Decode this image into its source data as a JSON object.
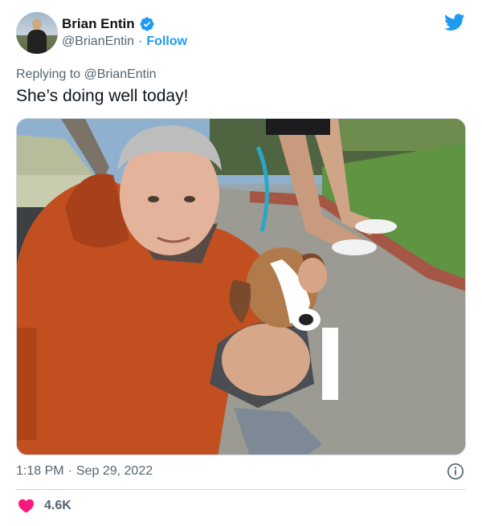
{
  "author": {
    "display_name": "Brian Entin",
    "handle": "@BrianEntin",
    "separator": "·",
    "follow_label": "Follow",
    "verified_icon": "verified-badge-icon"
  },
  "brand_icon": "twitter-bird-icon",
  "reply_context": "Replying to @BrianEntin",
  "tweet_text": "She’s doing well today!",
  "media": {
    "kind": "photo",
    "subject": "man in orange jacket with dog"
  },
  "timestamp": {
    "time": "1:18 PM",
    "separator": "·",
    "date": "Sep 29, 2022"
  },
  "info_icon": "info-icon",
  "engagement": {
    "likes": "4.6K",
    "like_icon": "heart-icon"
  },
  "colors": {
    "accent": "#1d9bf0",
    "text_primary": "#0f1419",
    "text_secondary": "#536471",
    "heart": "#f91880",
    "divider": "#cfd9de"
  }
}
